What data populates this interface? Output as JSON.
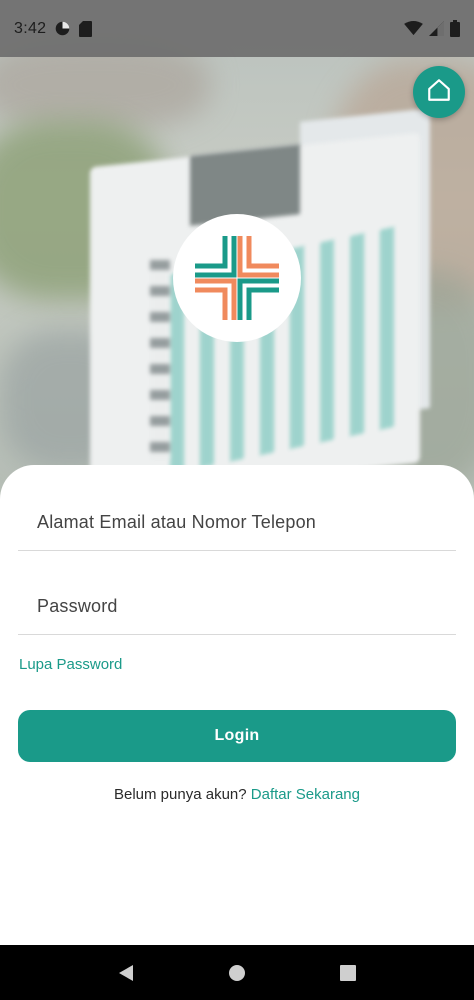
{
  "status_bar": {
    "time": "3:42",
    "left_icons": [
      "data-saver-icon",
      "sd-card-icon"
    ],
    "right_icons": [
      "wifi-icon",
      "cellular-signal-icon",
      "battery-icon"
    ]
  },
  "header": {
    "home_icon": "home-icon",
    "logo_icon": "hospital-cross-logo"
  },
  "form": {
    "email_placeholder": "Alamat Email atau Nomor Telepon",
    "email_value": "",
    "password_placeholder": "Password",
    "password_value": "",
    "forgot_password": "Lupa Password",
    "login_label": "Login",
    "signup_prompt": "Belum punya akun?",
    "signup_link": "Daftar Sekarang"
  },
  "nav_bar": {
    "back_icon": "back-triangle-icon",
    "home_icon": "home-circle-icon",
    "recents_icon": "recents-square-icon"
  },
  "colors": {
    "accent": "#1a9a89",
    "logo_orange": "#f08a5d",
    "logo_teal": "#1a9a89",
    "text": "#2a2a2a"
  }
}
